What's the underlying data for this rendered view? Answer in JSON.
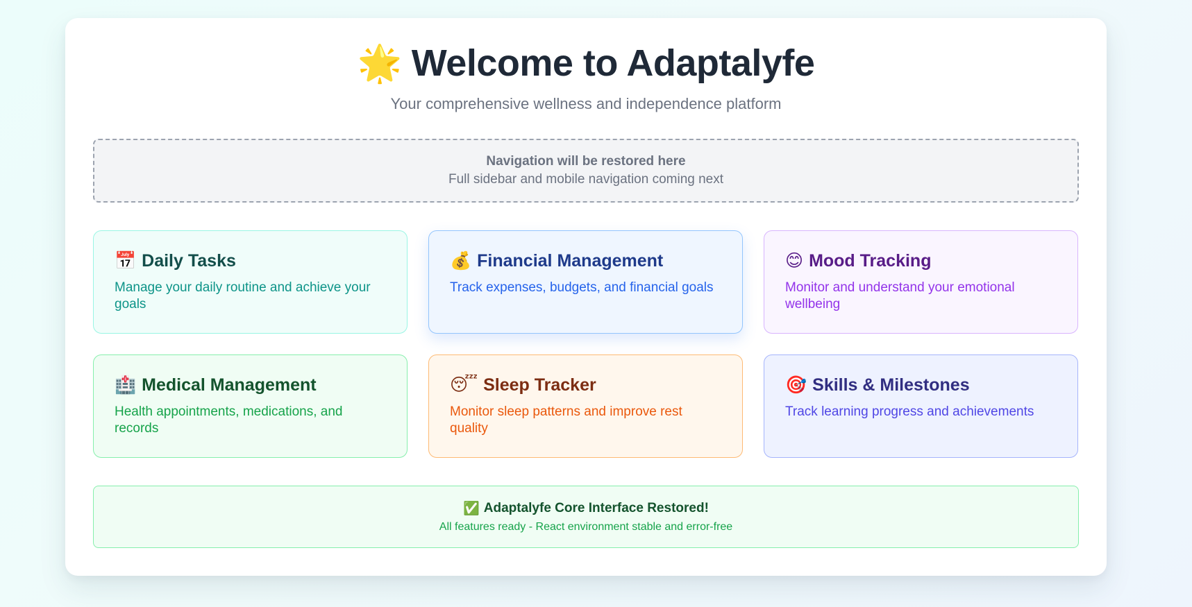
{
  "header": {
    "title_icon": "🌟",
    "title_icon_name": "star-icon",
    "title": "Welcome to Adaptalyfe",
    "subtitle": "Your comprehensive wellness and independence platform"
  },
  "navigation_placeholder": {
    "title": "Navigation will be restored here",
    "subtitle": "Full sidebar and mobile navigation coming next"
  },
  "features": [
    {
      "icon": "📅",
      "icon_name": "calendar-icon",
      "title": "Daily Tasks",
      "description": "Manage your daily routine and achieve your goals",
      "colors": {
        "bg": "#f0fdfa",
        "border": "#99f6e4",
        "title": "#134e4a",
        "text": "#0d9488"
      }
    },
    {
      "icon": "💰",
      "icon_name": "money-bag-icon",
      "title": "Financial Management",
      "description": "Track expenses, budgets, and financial goals",
      "colors": {
        "bg": "#eff6ff",
        "border": "#93c5fd",
        "title": "#1e3a8a",
        "text": "#2563eb"
      }
    },
    {
      "icon": "😊",
      "icon_name": "smile-icon",
      "title": "Mood Tracking",
      "description": "Monitor and understand your emotional wellbeing",
      "colors": {
        "bg": "#faf5ff",
        "border": "#d8b4fe",
        "title": "#581c87",
        "text": "#9333ea"
      }
    },
    {
      "icon": "🏥",
      "icon_name": "hospital-icon",
      "title": "Medical Management",
      "description": "Health appointments, medications, and records",
      "colors": {
        "bg": "#f0fdf4",
        "border": "#86efac",
        "title": "#14532d",
        "text": "#16a34a"
      }
    },
    {
      "icon": "😴",
      "icon_name": "sleeping-face-icon",
      "title": "Sleep Tracker",
      "description": "Monitor sleep patterns and improve rest quality",
      "colors": {
        "bg": "#fff7ed",
        "border": "#fdba74",
        "title": "#7c2d12",
        "text": "#ea580c"
      }
    },
    {
      "icon": "🎯",
      "icon_name": "target-icon",
      "title": "Skills & Milestones",
      "description": "Track learning progress and achievements",
      "colors": {
        "bg": "#eef2ff",
        "border": "#a5b4fc",
        "title": "#312e81",
        "text": "#4f46e5"
      }
    }
  ],
  "status": {
    "icon": "✅",
    "icon_name": "check-mark-icon",
    "title": "Adaptalyfe Core Interface Restored!",
    "subtitle": "All features ready - React environment stable and error-free"
  }
}
